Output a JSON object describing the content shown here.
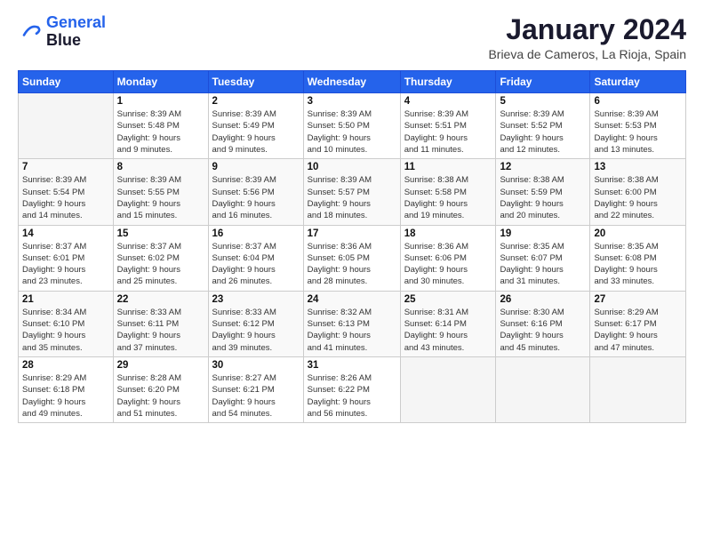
{
  "logo": {
    "line1": "General",
    "line2": "Blue"
  },
  "title": "January 2024",
  "subtitle": "Brieva de Cameros, La Rioja, Spain",
  "weekdays": [
    "Sunday",
    "Monday",
    "Tuesday",
    "Wednesday",
    "Thursday",
    "Friday",
    "Saturday"
  ],
  "weeks": [
    [
      {
        "day": "",
        "info": ""
      },
      {
        "day": "1",
        "info": "Sunrise: 8:39 AM\nSunset: 5:48 PM\nDaylight: 9 hours\nand 9 minutes."
      },
      {
        "day": "2",
        "info": "Sunrise: 8:39 AM\nSunset: 5:49 PM\nDaylight: 9 hours\nand 9 minutes."
      },
      {
        "day": "3",
        "info": "Sunrise: 8:39 AM\nSunset: 5:50 PM\nDaylight: 9 hours\nand 10 minutes."
      },
      {
        "day": "4",
        "info": "Sunrise: 8:39 AM\nSunset: 5:51 PM\nDaylight: 9 hours\nand 11 minutes."
      },
      {
        "day": "5",
        "info": "Sunrise: 8:39 AM\nSunset: 5:52 PM\nDaylight: 9 hours\nand 12 minutes."
      },
      {
        "day": "6",
        "info": "Sunrise: 8:39 AM\nSunset: 5:53 PM\nDaylight: 9 hours\nand 13 minutes."
      }
    ],
    [
      {
        "day": "7",
        "info": "Sunrise: 8:39 AM\nSunset: 5:54 PM\nDaylight: 9 hours\nand 14 minutes."
      },
      {
        "day": "8",
        "info": "Sunrise: 8:39 AM\nSunset: 5:55 PM\nDaylight: 9 hours\nand 15 minutes."
      },
      {
        "day": "9",
        "info": "Sunrise: 8:39 AM\nSunset: 5:56 PM\nDaylight: 9 hours\nand 16 minutes."
      },
      {
        "day": "10",
        "info": "Sunrise: 8:39 AM\nSunset: 5:57 PM\nDaylight: 9 hours\nand 18 minutes."
      },
      {
        "day": "11",
        "info": "Sunrise: 8:38 AM\nSunset: 5:58 PM\nDaylight: 9 hours\nand 19 minutes."
      },
      {
        "day": "12",
        "info": "Sunrise: 8:38 AM\nSunset: 5:59 PM\nDaylight: 9 hours\nand 20 minutes."
      },
      {
        "day": "13",
        "info": "Sunrise: 8:38 AM\nSunset: 6:00 PM\nDaylight: 9 hours\nand 22 minutes."
      }
    ],
    [
      {
        "day": "14",
        "info": "Sunrise: 8:37 AM\nSunset: 6:01 PM\nDaylight: 9 hours\nand 23 minutes."
      },
      {
        "day": "15",
        "info": "Sunrise: 8:37 AM\nSunset: 6:02 PM\nDaylight: 9 hours\nand 25 minutes."
      },
      {
        "day": "16",
        "info": "Sunrise: 8:37 AM\nSunset: 6:04 PM\nDaylight: 9 hours\nand 26 minutes."
      },
      {
        "day": "17",
        "info": "Sunrise: 8:36 AM\nSunset: 6:05 PM\nDaylight: 9 hours\nand 28 minutes."
      },
      {
        "day": "18",
        "info": "Sunrise: 8:36 AM\nSunset: 6:06 PM\nDaylight: 9 hours\nand 30 minutes."
      },
      {
        "day": "19",
        "info": "Sunrise: 8:35 AM\nSunset: 6:07 PM\nDaylight: 9 hours\nand 31 minutes."
      },
      {
        "day": "20",
        "info": "Sunrise: 8:35 AM\nSunset: 6:08 PM\nDaylight: 9 hours\nand 33 minutes."
      }
    ],
    [
      {
        "day": "21",
        "info": "Sunrise: 8:34 AM\nSunset: 6:10 PM\nDaylight: 9 hours\nand 35 minutes."
      },
      {
        "day": "22",
        "info": "Sunrise: 8:33 AM\nSunset: 6:11 PM\nDaylight: 9 hours\nand 37 minutes."
      },
      {
        "day": "23",
        "info": "Sunrise: 8:33 AM\nSunset: 6:12 PM\nDaylight: 9 hours\nand 39 minutes."
      },
      {
        "day": "24",
        "info": "Sunrise: 8:32 AM\nSunset: 6:13 PM\nDaylight: 9 hours\nand 41 minutes."
      },
      {
        "day": "25",
        "info": "Sunrise: 8:31 AM\nSunset: 6:14 PM\nDaylight: 9 hours\nand 43 minutes."
      },
      {
        "day": "26",
        "info": "Sunrise: 8:30 AM\nSunset: 6:16 PM\nDaylight: 9 hours\nand 45 minutes."
      },
      {
        "day": "27",
        "info": "Sunrise: 8:29 AM\nSunset: 6:17 PM\nDaylight: 9 hours\nand 47 minutes."
      }
    ],
    [
      {
        "day": "28",
        "info": "Sunrise: 8:29 AM\nSunset: 6:18 PM\nDaylight: 9 hours\nand 49 minutes."
      },
      {
        "day": "29",
        "info": "Sunrise: 8:28 AM\nSunset: 6:20 PM\nDaylight: 9 hours\nand 51 minutes."
      },
      {
        "day": "30",
        "info": "Sunrise: 8:27 AM\nSunset: 6:21 PM\nDaylight: 9 hours\nand 54 minutes."
      },
      {
        "day": "31",
        "info": "Sunrise: 8:26 AM\nSunset: 6:22 PM\nDaylight: 9 hours\nand 56 minutes."
      },
      {
        "day": "",
        "info": ""
      },
      {
        "day": "",
        "info": ""
      },
      {
        "day": "",
        "info": ""
      }
    ]
  ]
}
